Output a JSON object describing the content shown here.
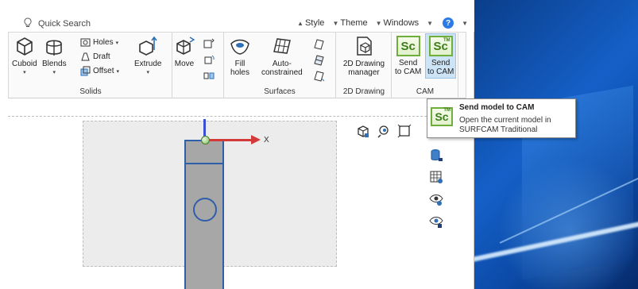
{
  "titlebar": {
    "quick_search": "Quick Search",
    "style": "Style",
    "theme": "Theme",
    "windows": "Windows",
    "help_icon": "help-icon"
  },
  "ribbon": {
    "solids": {
      "label": "Solids",
      "cuboid": "Cuboid",
      "blends": "Blends",
      "holes": "Holes",
      "draft": "Draft",
      "offset": "Offset",
      "extrude": "Extrude",
      "move": "Move"
    },
    "surfaces": {
      "label": "Surfaces",
      "fill_holes_1": "Fill",
      "fill_holes_2": "holes",
      "auto_constrained_1": "Auto-",
      "auto_constrained_2": "constrained"
    },
    "drawing": {
      "label": "2D Drawing",
      "manager_1": "2D Drawing",
      "manager_2": "manager"
    },
    "cam": {
      "label": "CAM",
      "send1_1": "Send",
      "send1_2": "to CAM",
      "send2_1": "Send",
      "send2_2": "to CAM",
      "sc": "Sc",
      "tm": "TM"
    }
  },
  "viewport": {
    "x_axis_label": "X"
  },
  "tooltip": {
    "title": "Send model to CAM",
    "description": "Open the current model in SURFCAM Traditional",
    "sc": "Sc",
    "tm": "TM"
  },
  "colors": {
    "sc_green": "#6fae3b",
    "selection_blue": "#cde4f7",
    "x_axis": "#d23a3a",
    "y_axis": "#3b4fd6",
    "part_outline": "#2f5fa8"
  }
}
